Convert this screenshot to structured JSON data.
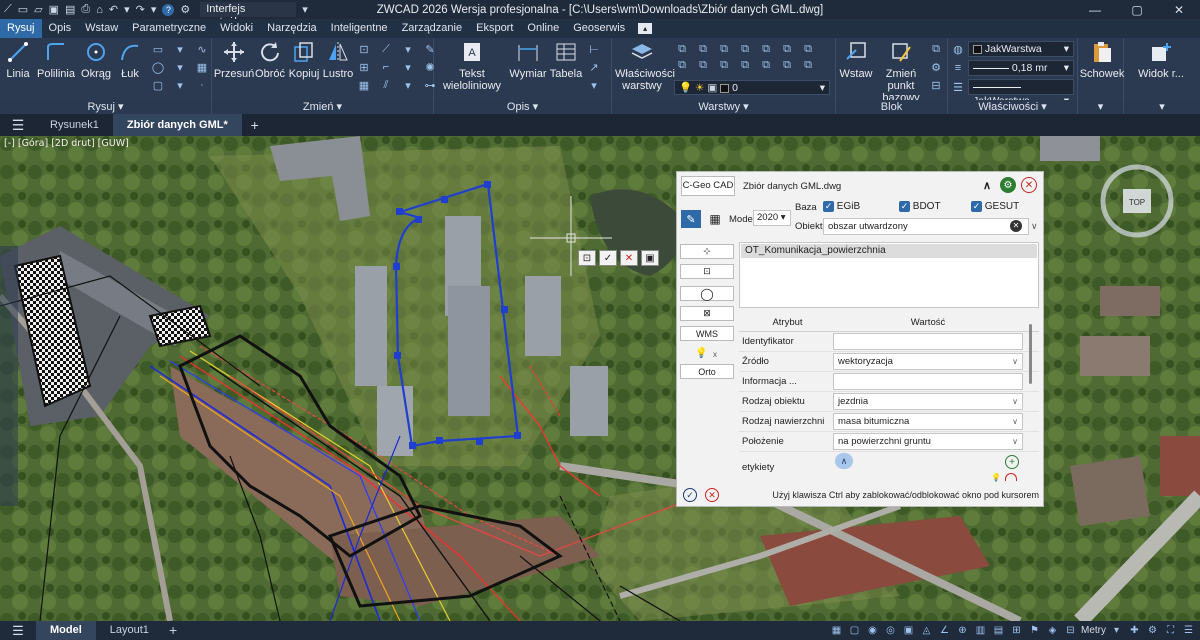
{
  "titlebar": {
    "workspace": "Interfejs wstążkowy",
    "title": "ZWCAD 2026 Wersja profesjonalna - [C:\\Users\\wm\\Downloads\\Zbiór danych GML.dwg]"
  },
  "menu": [
    "Rysuj",
    "Opis",
    "Wstaw",
    "Parametryczne",
    "Widoki",
    "Narzędzia",
    "Inteligentne",
    "Zarządzanie",
    "Eksport",
    "Online",
    "Geoserwis"
  ],
  "ribbon": {
    "rysuj": {
      "label": "Rysuj",
      "buttons": [
        "Linia",
        "Polilinia",
        "Okrąg",
        "Łuk"
      ]
    },
    "zmien": {
      "label": "Zmień",
      "buttons": [
        "Przesuń",
        "Obróć",
        "Kopiuj",
        "Lustro"
      ]
    },
    "opis": {
      "label": "Opis",
      "buttons": [
        "Tekst wieloliniowy",
        "Wymiar",
        "Tabela"
      ]
    },
    "warstwy": {
      "label": "Warstwy",
      "button": "Właściwości warstwy",
      "layer": "0"
    },
    "blok": {
      "label": "Blok",
      "buttons": [
        "Wstaw",
        "Zmień punkt bazowy"
      ]
    },
    "wlasciwosci": {
      "label": "Właściwości",
      "color": "JakWarstwa",
      "lineweight": "0,18 mr",
      "linetype": "JakWarstwa"
    },
    "schowek": {
      "button": "Schowek"
    },
    "widok": {
      "button": "Widok r..."
    }
  },
  "doctabs": {
    "tabs": [
      "Rysunek1",
      "Zbiór danych GML*"
    ]
  },
  "viewport": {
    "label": "[-] [Góra] [2D drut] [GUW]",
    "navcube": "TOP"
  },
  "panel": {
    "cgeo": "C-Geo CAD",
    "filename": "Zbiór danych GML.dwg",
    "model_label": "Model",
    "model_value": "2020",
    "baza_label": "Baza",
    "bazy": [
      "EGiB",
      "BDOT",
      "GESUT"
    ],
    "obiekt_label": "Obiekt",
    "obiekt_value": "obszar utwardzony",
    "selected_class": "OT_Komunikacja_powierzchnia",
    "side_buttons": [
      "WMS",
      "Orto"
    ],
    "table": {
      "col_attr": "Atrybut",
      "col_value": "Wartość",
      "rows": [
        {
          "k": "Identyfikator",
          "v": ""
        },
        {
          "k": "Źródło",
          "v": "wektoryzacja"
        },
        {
          "k": "Informacja ...",
          "v": ""
        },
        {
          "k": "Rodzaj obiektu",
          "v": "jezdnia"
        },
        {
          "k": "Rodzaj nawierzchni",
          "v": "masa bitumiczna"
        },
        {
          "k": "Położenie",
          "v": "na powierzchni gruntu"
        }
      ],
      "etykiety": "etykiety"
    },
    "hint": "Użyj klawisza Ctrl aby zablokować/odblokować okno pod kursorem"
  },
  "status": {
    "tabs": [
      "Model",
      "Layout1"
    ],
    "scale": "Metry"
  },
  "colors": {
    "accent": "#2f6aa8",
    "selection": "#1f3fd0"
  }
}
